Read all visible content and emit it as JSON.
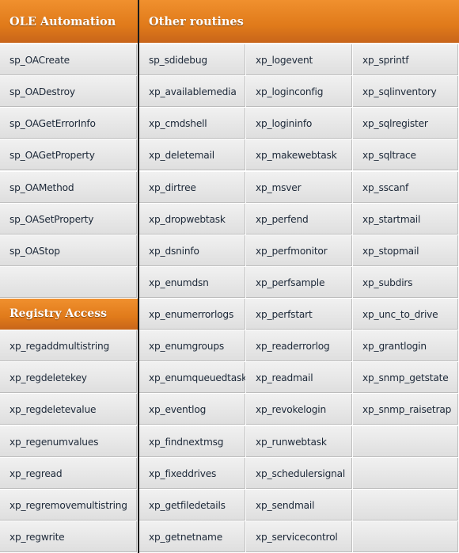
{
  "headers": {
    "ole": "OLE Automation",
    "other": "Other routines",
    "registry": "Registry Access"
  },
  "ole_items": [
    "sp_OACreate",
    "sp_OADestroy",
    "sp_OAGetErrorInfo",
    "sp_OAGetProperty",
    "sp_OAMethod",
    "sp_OASetProperty",
    "sp_OAStop"
  ],
  "registry_items": [
    "xp_regaddmultistring",
    "xp_regdeletekey",
    "xp_regdeletevalue",
    "xp_regenumvalues",
    "xp_regread",
    "xp_regremovemultistring",
    "xp_regwrite"
  ],
  "other_col1": [
    "sp_sdidebug",
    "xp_availablemedia",
    "xp_cmdshell",
    "xp_deletemail",
    "xp_dirtree",
    "xp_dropwebtask",
    "xp_dsninfo",
    "xp_enumdsn",
    "xp_enumerrorlogs",
    "xp_enumgroups",
    "xp_enumqueuedtasks",
    "xp_eventlog",
    "xp_findnextmsg",
    "xp_fixeddrives",
    "xp_getfiledetails",
    "xp_getnetname"
  ],
  "other_col2": [
    "xp_logevent",
    "xp_loginconfig",
    "xp_logininfo",
    "xp_makewebtask",
    "xp_msver",
    "xp_perfend",
    "xp_perfmonitor",
    "xp_perfsample",
    "xp_perfstart",
    "xp_readerrorlog",
    "xp_readmail",
    "xp_revokelogin",
    "xp_runwebtask",
    "xp_schedulersignal",
    "xp_sendmail",
    "xp_servicecontrol"
  ],
  "other_col3": [
    "xp_sprintf",
    "xp_sqlinventory",
    "xp_sqlregister",
    "xp_sqltrace",
    "xp_sscanf",
    "xp_startmail",
    "xp_stopmail",
    "xp_subdirs",
    "xp_unc_to_drive",
    "xp_grantlogin",
    "xp_snmp_getstate",
    "xp_snmp_raisetrap",
    "",
    "",
    "",
    ""
  ],
  "colors": {
    "accent": "#e07a1a",
    "text": "#1c2838"
  }
}
